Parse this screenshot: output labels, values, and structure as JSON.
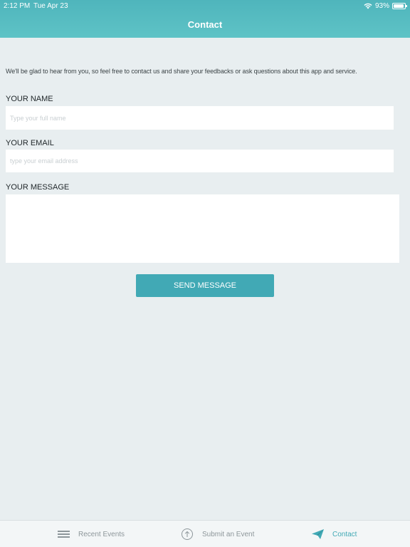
{
  "status_bar": {
    "time": "2:12 PM",
    "date": "Tue Apr 23",
    "battery": "93%",
    "battery_level": 0.93
  },
  "nav": {
    "title": "Contact"
  },
  "contact_form": {
    "intro": "We'll be glad to hear from you, so feel free to contact us and share your feedbacks or ask questions about this app and service.",
    "name_label": "YOUR NAME",
    "name_placeholder": "Type your full name",
    "name_value": "",
    "email_label": "YOUR EMAIL",
    "email_placeholder": "type your email address",
    "email_value": "",
    "message_label": "YOUR MESSAGE",
    "message_value": "",
    "send_label": "SEND MESSAGE"
  },
  "tab_bar": {
    "tabs": [
      {
        "label": "Recent Events",
        "icon": "list-icon",
        "active": false
      },
      {
        "label": "Submit an Event",
        "icon": "upload-icon",
        "active": false
      },
      {
        "label": "Contact",
        "icon": "paper-plane-icon",
        "active": true
      }
    ]
  },
  "colors": {
    "header": "#56bcc1",
    "accent": "#41a9b5",
    "background": "#e8eef0"
  }
}
